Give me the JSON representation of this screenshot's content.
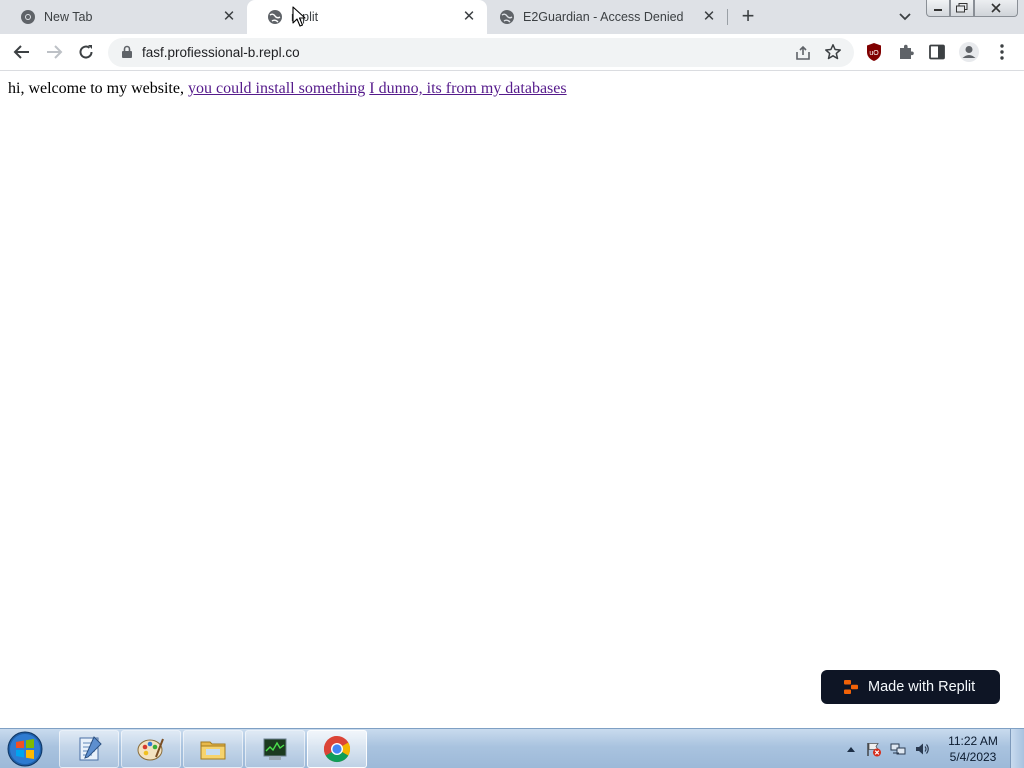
{
  "browser": {
    "tabs": [
      {
        "title": "New Tab",
        "icon": "chrome-icon",
        "active": false
      },
      {
        "title": "replit",
        "icon": "globe-icon",
        "active": true
      },
      {
        "title": "E2Guardian - Access Denied",
        "icon": "globe-icon",
        "active": false
      }
    ],
    "new_tab_label": "+",
    "close_glyph": "✕",
    "address_bar": {
      "url": "fasf.profiessional-b.repl.co"
    }
  },
  "page": {
    "intro_text": "hi, welcome to my website,",
    "link_1": "you could install something",
    "link_2": "I dunno, its from my databases",
    "badge_label": "Made with Replit"
  },
  "taskbar": {
    "apps": [
      "notepad-icon",
      "paint-icon",
      "explorer-icon",
      "task-manager-icon",
      "chrome-icon"
    ],
    "clock_time": "11:22 AM",
    "clock_date": "5/4/2023"
  },
  "colors": {
    "tabstrip": "#dee1e6",
    "visited_link": "#551a8b",
    "badge_bg": "#0e1525",
    "replit_orange": "#f26207",
    "ublock_red": "#800000"
  }
}
